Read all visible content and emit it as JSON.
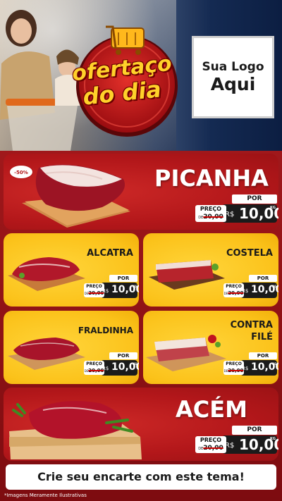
{
  "header": {
    "badge_line1": "ofertaço",
    "badge_line2": "do dia",
    "logo_line1": "Sua Logo",
    "logo_line2": "Aqui"
  },
  "products": [
    {
      "name": "PICANHA",
      "discount": "-50%",
      "por_label": "POR",
      "preco_label": "PREÇO",
      "de_label": "DE",
      "old_price": "20,00",
      "currency": "R$",
      "price": "10,00",
      "unit": "KG"
    },
    {
      "name": "ALCATRA",
      "por_label": "POR",
      "preco_label": "PREÇO",
      "de_label": "DE",
      "old_price": "20,00",
      "currency": "R$",
      "price": "10,00",
      "unit": "KG"
    },
    {
      "name": "COSTELA",
      "por_label": "POR",
      "preco_label": "PREÇO",
      "de_label": "DE",
      "old_price": "20,00",
      "currency": "R$",
      "price": "10,00",
      "unit": "KG"
    },
    {
      "name": "FRALDINHA",
      "por_label": "POR",
      "preco_label": "PREÇO",
      "de_label": "DE",
      "old_price": "20,00",
      "currency": "R$",
      "price": "10,00",
      "unit": "KG"
    },
    {
      "name_line1": "CONTRA",
      "name_line2": "FILÉ",
      "por_label": "POR",
      "preco_label": "PREÇO",
      "de_label": "DE",
      "old_price": "20,00",
      "currency": "R$",
      "price": "10,00",
      "unit": "KG"
    },
    {
      "name": "ACÉM",
      "por_label": "POR",
      "preco_label": "PREÇO",
      "de_label": "DE",
      "old_price": "20,00",
      "currency": "R$",
      "price": "10,00",
      "unit": "KG"
    }
  ],
  "cta": "Crie seu encarte com este tema!",
  "disclaimer": "*Imagens Meramente Ilustrativas",
  "colors": {
    "red": "#b3171a",
    "yellow": "#fbc21a",
    "dark": "#1b1b1b",
    "gold": "#ffd12a"
  }
}
